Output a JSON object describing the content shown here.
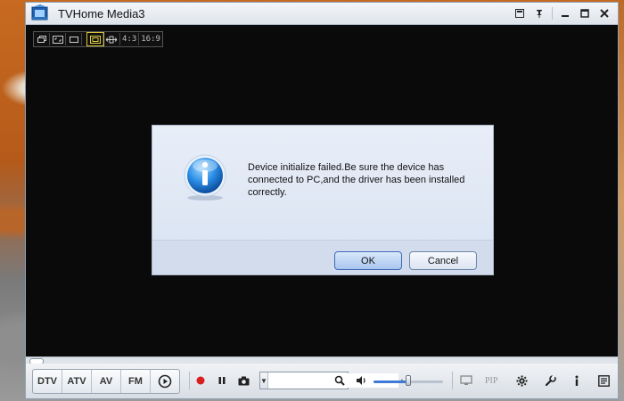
{
  "window": {
    "title": "TVHome Media3"
  },
  "window_controls": {
    "icons": [
      "compact-mode-icon",
      "pin-icon",
      "minimize-icon",
      "maximize-icon",
      "close-icon"
    ]
  },
  "aspect_bar": {
    "ratio_4_3": "4:3",
    "ratio_16_9": "16:9"
  },
  "dialog": {
    "message": "Device initialize failed.Be sure the device has connected to PC,and the driver has been installed correctly.",
    "ok_label": "OK",
    "cancel_label": "Cancel"
  },
  "controls": {
    "sources": {
      "dtv": "DTV",
      "atv": "ATV",
      "av": "AV",
      "fm": "FM"
    },
    "channel_value": "",
    "pip_label": "PIP",
    "volume_level": 0.5
  },
  "colors": {
    "accent": "#3d7bd6",
    "record": "#d81e1e",
    "video_bg": "#0a0a0a"
  }
}
